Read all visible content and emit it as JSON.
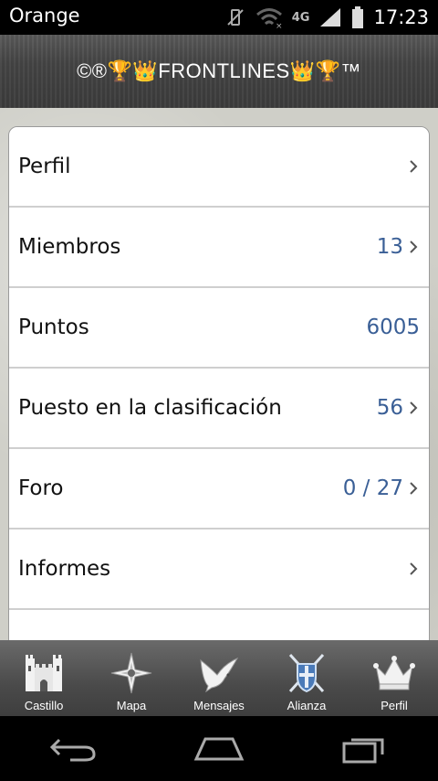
{
  "status_bar": {
    "carrier": "Orange",
    "network": "4G",
    "time": "17:23"
  },
  "header": {
    "title": "©®🏆👑FRONTLINES👑🏆™"
  },
  "menu": {
    "items": [
      {
        "label": "Perfil",
        "value": "",
        "chevron": true
      },
      {
        "label": "Miembros",
        "value": "13",
        "chevron": true
      },
      {
        "label": "Puntos",
        "value": "6005",
        "chevron": false
      },
      {
        "label": "Puesto en la clasificación",
        "value": "56",
        "chevron": true
      },
      {
        "label": "Foro",
        "value": "0 / 27",
        "chevron": true
      },
      {
        "label": "Informes",
        "value": "",
        "chevron": true
      }
    ]
  },
  "tabs": [
    {
      "label": "Castillo",
      "icon": "castle-icon"
    },
    {
      "label": "Mapa",
      "icon": "compass-star-icon"
    },
    {
      "label": "Mensajes",
      "icon": "dove-icon"
    },
    {
      "label": "Alianza",
      "icon": "crossed-swords-shield-icon",
      "active": true
    },
    {
      "label": "Perfil",
      "icon": "crown-icon"
    }
  ],
  "colors": {
    "value_blue": "#3a5f96",
    "tab_bar": "#4a4a4a",
    "active_tab_accent": "#4a7ab8"
  }
}
